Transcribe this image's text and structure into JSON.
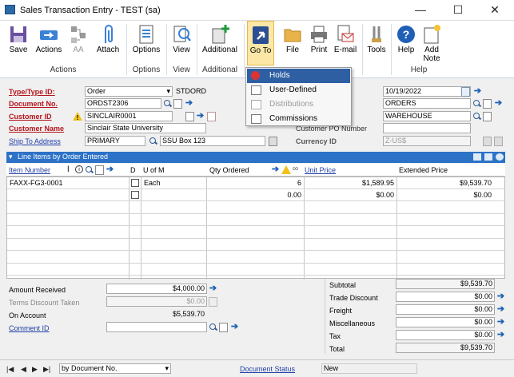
{
  "window": {
    "title": "Sales Transaction Entry  -  TEST (sa)",
    "minimize": "—",
    "maximize": "☐",
    "close": "✕"
  },
  "ribbon": {
    "buttons": [
      {
        "label": "Save",
        "icon": "save-icon"
      },
      {
        "label": "Actions",
        "icon": "actions-icon"
      },
      {
        "label": "AA",
        "icon": "aa-icon"
      },
      {
        "label": "Attach",
        "icon": "paperclip-icon"
      },
      {
        "label": "Options",
        "icon": "options-icon"
      },
      {
        "label": "View",
        "icon": "view-icon"
      },
      {
        "label": "Additional",
        "icon": "additional-icon"
      },
      {
        "label": "Go To",
        "icon": "goto-icon"
      },
      {
        "label": "File",
        "icon": "folder-icon"
      },
      {
        "label": "Print",
        "icon": "printer-icon"
      },
      {
        "label": "E-mail",
        "icon": "email-icon"
      },
      {
        "label": "Tools",
        "icon": "tools-icon"
      },
      {
        "label": "Help",
        "icon": "help-icon"
      },
      {
        "label": "Add\nNote",
        "icon": "note-icon"
      }
    ],
    "groups": [
      "Actions",
      "Options",
      "View",
      "Additional",
      "Help"
    ]
  },
  "goto_menu": {
    "items": [
      {
        "label": "Holds",
        "icon": "holds-icon",
        "highlighted": true
      },
      {
        "label": "User-Defined",
        "icon": "user-defined-icon"
      },
      {
        "label": "Distributions",
        "icon": "distributions-icon",
        "disabled": true
      },
      {
        "label": "Commissions",
        "icon": "commissions-icon"
      }
    ]
  },
  "header": {
    "type_label": "Type/Type ID:",
    "type_value": "Order",
    "type_id": "STDORD",
    "docno_label": "Document No.",
    "docno_value": "ORDST2306",
    "custid_label": "Customer ID",
    "custid_value": "SINCLAIR0001",
    "custname_label": "Customer Name",
    "custname_value": "Sinclair State University",
    "shipto_label": "Ship To Address",
    "shipto_value": "PRIMARY",
    "shipto_addr": "SSU Box 123",
    "date_value": "10/19/2022",
    "batch_value": "ORDERS",
    "site_value": "WAREHOUSE",
    "custpo_label": "Customer PO Number",
    "currency_label": "Currency ID",
    "currency_value": "Z-US$"
  },
  "grid": {
    "title": "Line Items by Order Entered",
    "columns": {
      "item": "Item Number",
      "d": "D",
      "uom": "U of M",
      "qty": "Qty Ordered",
      "price": "Unit Price",
      "ext": "Extended Price"
    },
    "rows": [
      {
        "item": "FAXX-FG3-0001",
        "uom": "Each",
        "qty": "6",
        "price": "$1,589.95",
        "ext": "$9,539.70"
      },
      {
        "item": "",
        "uom": "",
        "qty": "0.00",
        "price": "$0.00",
        "ext": "$0.00"
      }
    ]
  },
  "summary_left": {
    "amount_received_label": "Amount Received",
    "amount_received": "$4,000.00",
    "terms_discount_label": "Terms Discount Taken",
    "terms_discount": "$0.00",
    "on_account_label": "On Account",
    "on_account": "$5,539.70",
    "comment_label": "Comment ID"
  },
  "summary_right": [
    {
      "label": "Subtotal",
      "value": "$9,539.70"
    },
    {
      "label": "Trade Discount",
      "value": "$0.00"
    },
    {
      "label": "Freight",
      "value": "$0.00"
    },
    {
      "label": "Miscellaneous",
      "value": "$0.00"
    },
    {
      "label": "Tax",
      "value": "$0.00"
    },
    {
      "label": "Total",
      "value": "$9,539.70"
    }
  ],
  "statusbar": {
    "sort": "by Document No.",
    "doc_status_label": "Document Status",
    "doc_status": "New"
  },
  "colors": {
    "accent_blue": "#2c72c7",
    "required_red": "#b5141d",
    "link_blue": "#1f3ea8",
    "menu_highlight": "#2f5fa3"
  }
}
